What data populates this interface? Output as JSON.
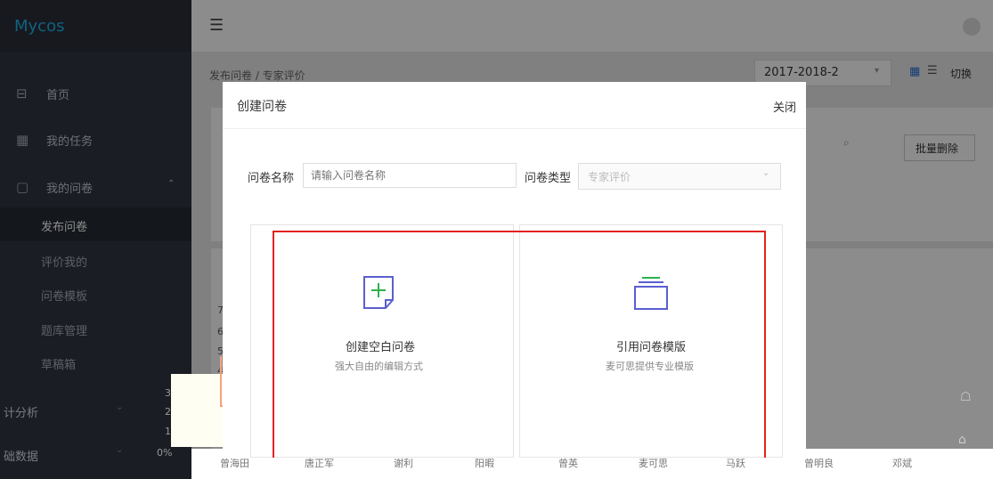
{
  "logo": "Mycos",
  "sidebar": {
    "items": [
      {
        "label": "首页",
        "icon": "layout-icon"
      },
      {
        "label": "我的任务",
        "icon": "calendar-icon"
      },
      {
        "label": "我的问卷",
        "icon": "document-icon"
      }
    ],
    "sub_items": [
      "发布问卷",
      "评价我的",
      "问卷模板",
      "题库管理",
      "草稿箱"
    ],
    "bottom_items": [
      "计分析",
      "础数据"
    ]
  },
  "header": {
    "menu_icon": "menu-icon"
  },
  "breadcrumb": "发布问卷 / 专家评价",
  "semester_select": "2017-2018-2",
  "switch_label": "切换",
  "batch_delete": "批量删除",
  "chart": {
    "y_ticks": [
      "7",
      "6",
      "5",
      "4",
      "3",
      "2",
      "1",
      "0%"
    ],
    "x_labels": [
      "曾海田",
      "唐正军",
      "谢利",
      "阳暇",
      "曾英",
      "麦可思",
      "马跃",
      "曾明良",
      "邓斌"
    ]
  },
  "modal": {
    "title": "创建问卷",
    "close": "关闭",
    "name_label": "问卷名称",
    "name_placeholder": "请输入问卷名称",
    "type_label": "问卷类型",
    "type_value": "专家评价",
    "card_blank": {
      "title": "创建空白问卷",
      "desc": "强大自由的编辑方式"
    },
    "card_template": {
      "title": "引用问卷模版",
      "desc": "麦可思提供专业模版"
    }
  },
  "accent_color": "#1fb1ea",
  "highlight_color": "#e1231f"
}
